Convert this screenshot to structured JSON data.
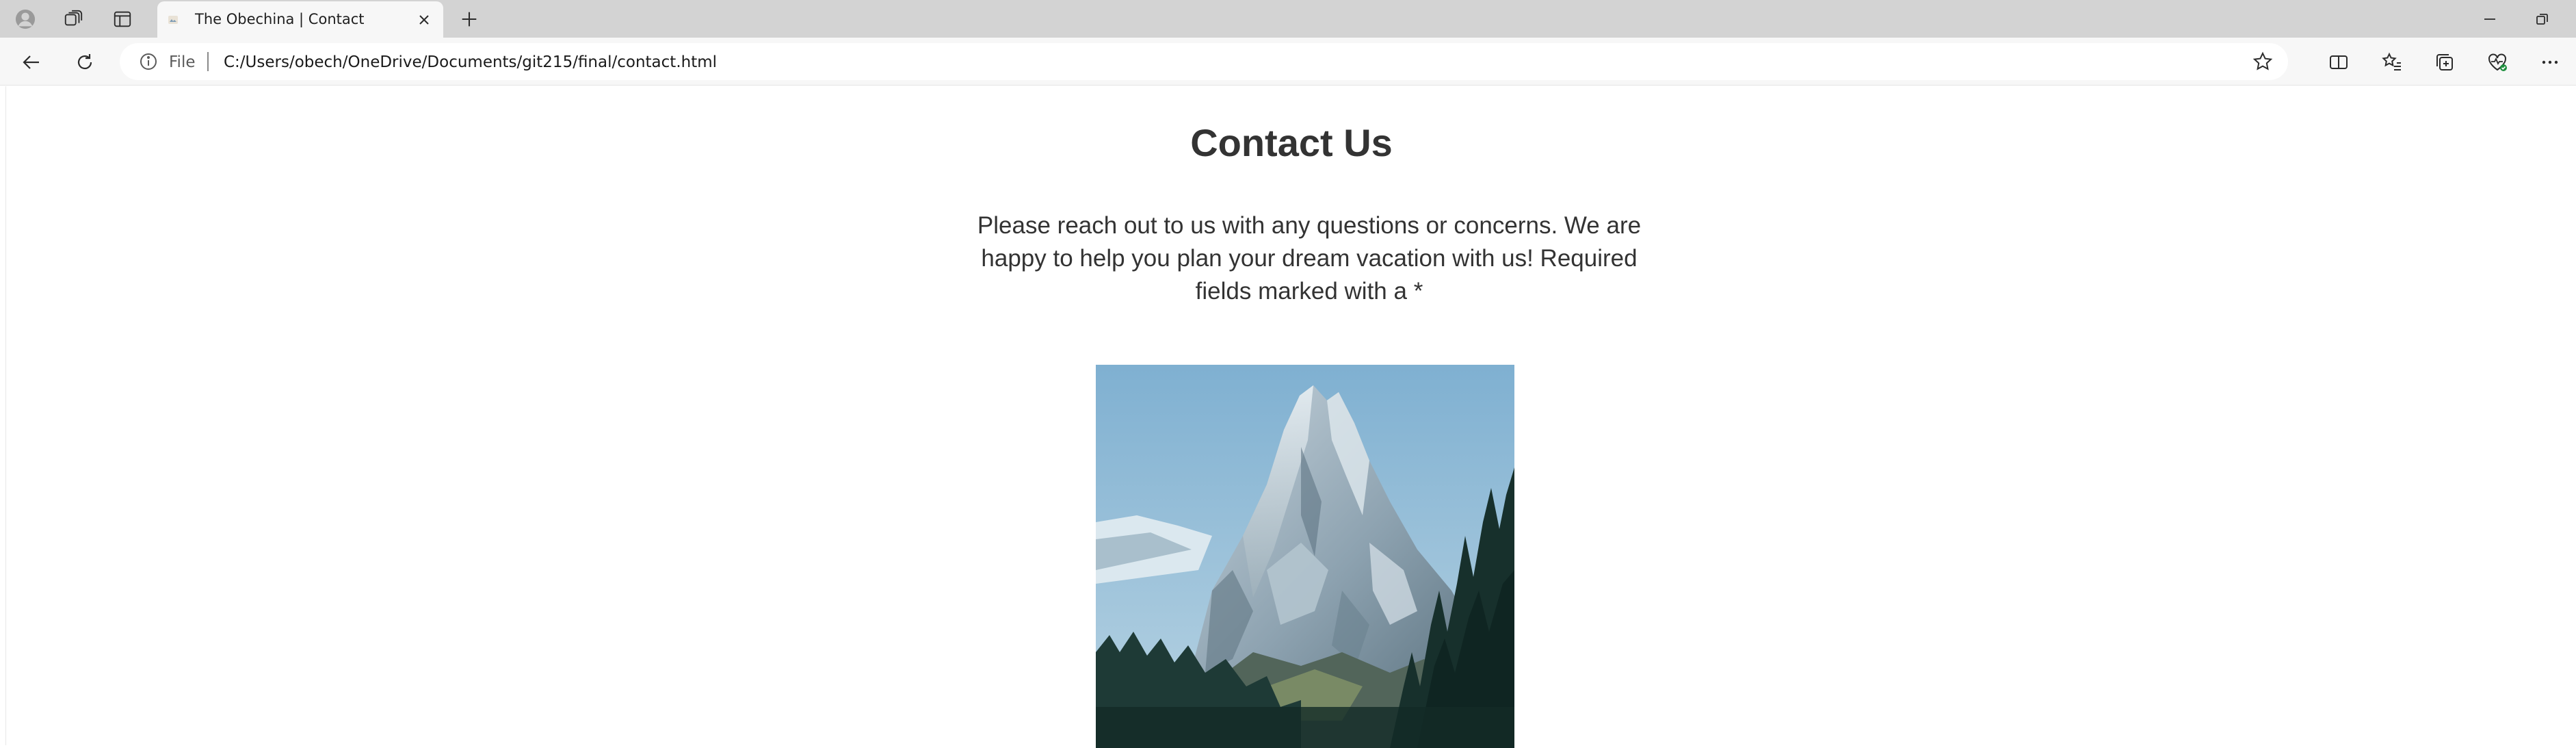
{
  "browser": {
    "tab": {
      "title": "The Obechina | Contact"
    },
    "address_bar": {
      "scheme_label": "File",
      "url": "C:/Users/obech/OneDrive/Documents/git215/final/contact.html"
    },
    "icons": {
      "profile": "profile-icon",
      "workspaces": "workspaces-icon",
      "tab_actions": "vertical-tabs-icon",
      "favicon": "site-favicon",
      "close_tab": "close-icon",
      "new_tab": "plus-icon",
      "minimize": "minimize-icon",
      "restore": "restore-icon",
      "back": "back-arrow-icon",
      "refresh": "refresh-icon",
      "info": "info-icon",
      "favorite": "star-icon",
      "split_screen": "split-screen-icon",
      "favorites": "favorites-icon",
      "collections": "collections-icon",
      "browser_essentials": "heart-pulse-icon",
      "settings": "more-icon"
    }
  },
  "page": {
    "heading": "Contact Us",
    "intro": "Please reach out to us with any questions or concerns. We are happy to help you plan your dream vacation with us! Required fields marked with a *",
    "image": {
      "subject": "mountain-photo"
    }
  }
}
